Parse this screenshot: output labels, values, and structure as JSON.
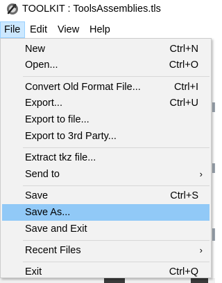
{
  "window": {
    "title": "TOOLKIT : ToolsAssemblies.tls",
    "icon": "toolkit-app-icon"
  },
  "menubar": {
    "items": [
      {
        "label": "File"
      },
      {
        "label": "Edit"
      },
      {
        "label": "View"
      },
      {
        "label": "Help"
      }
    ]
  },
  "file_menu": {
    "items": [
      {
        "label": "New",
        "shortcut": "Ctrl+N"
      },
      {
        "label": "Open...",
        "shortcut": "Ctrl+O"
      },
      {
        "label": "Convert Old Format File...",
        "shortcut": "Ctrl+I"
      },
      {
        "label": "Export...",
        "shortcut": "Ctrl+U"
      },
      {
        "label": "Export to file...",
        "shortcut": ""
      },
      {
        "label": "Export to 3rd Party...",
        "shortcut": ""
      },
      {
        "label": "Extract tkz file...",
        "shortcut": ""
      },
      {
        "label": "Send to",
        "submenu_arrow": "›"
      },
      {
        "label": "Save",
        "shortcut": "Ctrl+S"
      },
      {
        "label": "Save As...",
        "shortcut": "",
        "highlighted": true
      },
      {
        "label": "Save and Exit",
        "shortcut": ""
      },
      {
        "label": "Recent Files",
        "submenu_arrow": "›"
      },
      {
        "label": "Exit",
        "shortcut": "Ctrl+Q"
      }
    ]
  },
  "colors": {
    "menubar_selected": "#cce8ff",
    "menu_background": "#f2f2f2",
    "item_highlight": "#91c9f7"
  }
}
